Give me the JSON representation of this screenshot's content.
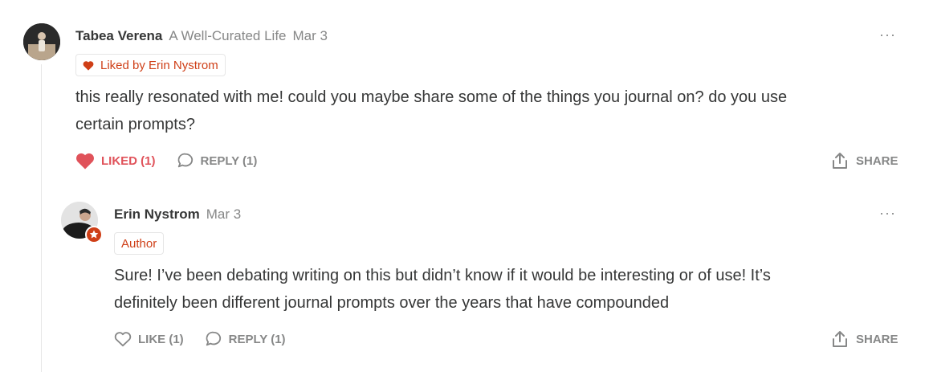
{
  "thread": [
    {
      "author": "Tabea Verena",
      "publication": "A Well-Curated Life",
      "date": "Mar 3",
      "badge": "Liked by Erin Nystrom",
      "body_line1": "this really resonated with me! could you maybe share some of the things you journal on? do you use",
      "body_line2": "certain prompts?",
      "like_label": "LIKED (1)",
      "reply_label": "REPLY (1)",
      "share_label": "SHARE",
      "more_label": "···"
    },
    {
      "author": "Erin Nystrom",
      "date": "Mar 3",
      "badge": "Author",
      "body_line1": "Sure! I’ve been debating writing on this but didn’t know if it would be interesting or of use! It’s",
      "body_line2": "definitely been different journal prompts over the years that have compounded",
      "like_label": "LIKE (1)",
      "reply_label": "REPLY (1)",
      "share_label": "SHARE",
      "more_label": "···"
    }
  ],
  "colors": {
    "accent": "#cf3f17",
    "liked": "#e0525a",
    "muted": "#868787",
    "text": "#363737"
  },
  "icons": [
    "heart-icon",
    "comment-bubble-icon",
    "share-upload-icon",
    "star-icon"
  ]
}
